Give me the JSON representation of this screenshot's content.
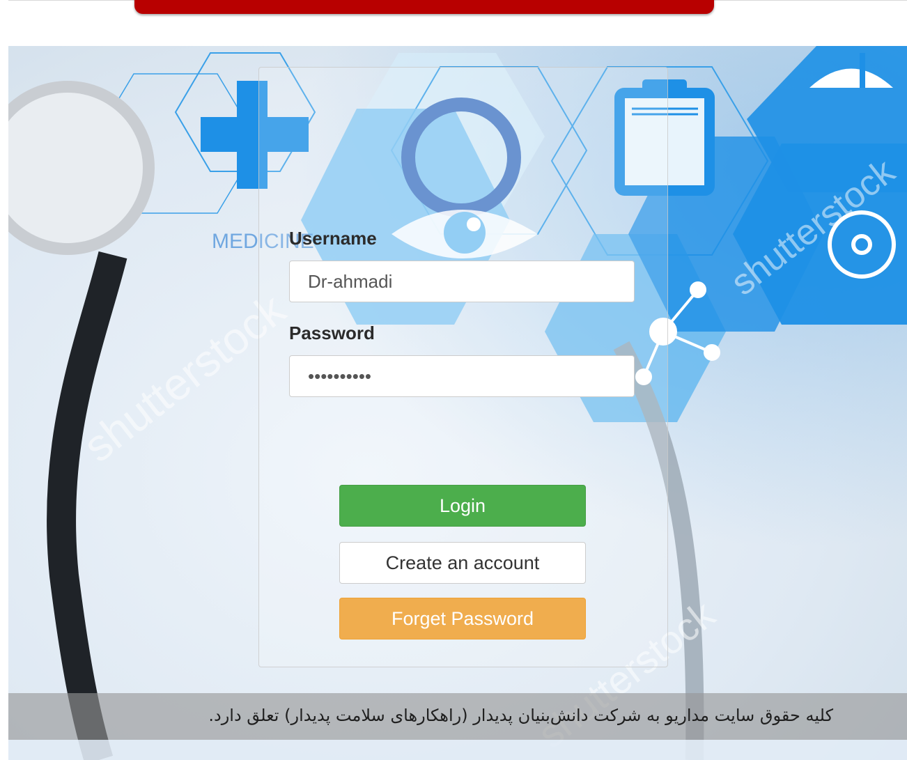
{
  "form": {
    "username_label": "Username",
    "username_value": "Dr-ahmadi",
    "password_label": "Password",
    "password_value": "••••••••••"
  },
  "buttons": {
    "login": "Login",
    "create_account": "Create an account",
    "forget_password": "Forget Password"
  },
  "footer": {
    "copyright": "کلیه حقوق سایت مداریو به شرکت دانش‌بنیان پدیدار (راهکارهای سلامت پدیدار) تعلق دارد."
  },
  "background": {
    "word": "MEDICINE",
    "watermark": "shutterstock"
  },
  "colors": {
    "login": "#4cae4c",
    "forget": "#f0ad4e",
    "accent_blue": "#1e90e6",
    "red_tab": "#b80000"
  },
  "icons": [
    "medical-cross-icon",
    "stethoscope-icon",
    "clipboard-icon",
    "eye-icon",
    "wheelchair-icon",
    "molecule-icon"
  ]
}
